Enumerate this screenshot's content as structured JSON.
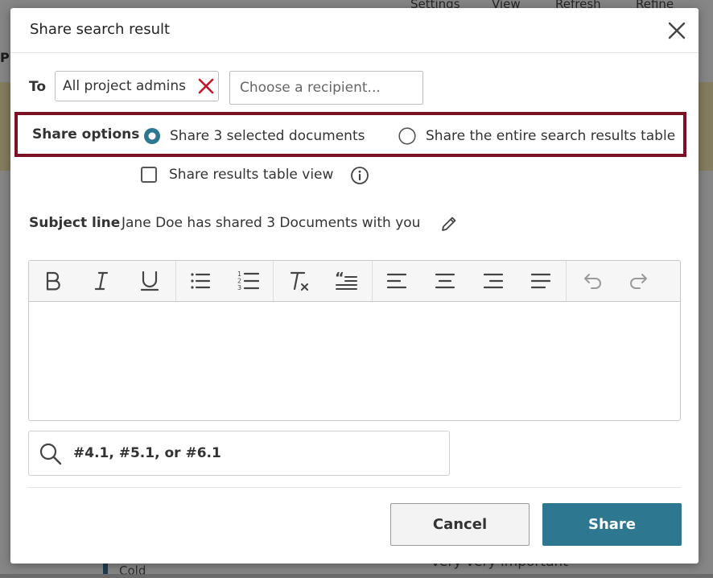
{
  "background": {
    "toolbar_items": [
      "Settings",
      "View",
      "Refresh",
      "Refine"
    ],
    "side_letter": "P",
    "row_text_left": "Cold",
    "row_text_right": "very very important"
  },
  "dialog": {
    "title": "Share search result",
    "close_icon": "close-icon",
    "to": {
      "label": "To",
      "chip_label": "All project admins",
      "chip_remove_icon": "remove-x-icon",
      "recipient_placeholder": "Choose a recipient..."
    },
    "share_options": {
      "label": "Share options",
      "option_selected": "Share 3 selected documents",
      "option_other": "Share the entire search results table",
      "selected_index": 0,
      "highlight_color": "#7a1224"
    },
    "checkbox": {
      "label": "Share results table view",
      "checked": false,
      "info_icon": "info-icon"
    },
    "subject": {
      "label": "Subject line",
      "text": "Jane Doe has shared 3 Documents with you",
      "edit_icon": "pencil-icon"
    },
    "editor_toolbar": [
      "bold-icon",
      "italic-icon",
      "underline-icon",
      "bulleted-list-icon",
      "numbered-list-icon",
      "clear-formatting-icon",
      "blockquote-icon",
      "align-left-icon",
      "align-center-icon",
      "align-right-icon",
      "justify-icon",
      "undo-icon",
      "redo-icon"
    ],
    "reference_search": {
      "icon": "search-icon",
      "value": "#4.1, #5.1, or #6.1"
    },
    "buttons": {
      "cancel": "Cancel",
      "share": "Share"
    },
    "colors": {
      "primary": "#2e7790",
      "error_x": "#c0182a"
    }
  }
}
